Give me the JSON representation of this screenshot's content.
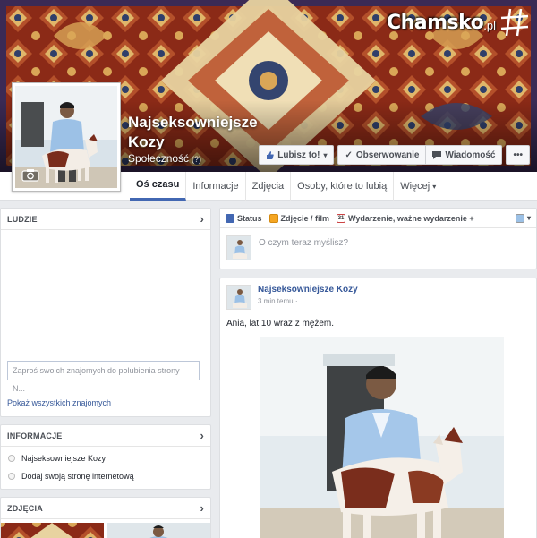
{
  "watermark": {
    "brand": "Chamsko",
    "suffix": ".pl"
  },
  "page": {
    "name": "Najseksowniejsze Kozy",
    "category": "Społeczność",
    "category_help": "(?)"
  },
  "cover_actions": {
    "like_label": "Lubisz to!",
    "follow_label": "Obserwowanie",
    "message_label": "Wiadomość",
    "more_label": "•••"
  },
  "tabs": [
    {
      "label": "Oś czasu"
    },
    {
      "label": "Informacje"
    },
    {
      "label": "Zdjęcia"
    },
    {
      "label": "Osoby, które to lubią"
    },
    {
      "label": "Więcej"
    }
  ],
  "sidebar": {
    "people": {
      "title": "LUDZIE",
      "invite_placeholder": "Zaproś swoich znajomych do polubienia strony N...",
      "show_all": "Pokaż wszystkich znajomych"
    },
    "info": {
      "title": "INFORMACJE",
      "items": [
        "Najseksowniejsze Kozy",
        "Dodaj swoją stronę internetową"
      ]
    },
    "photos": {
      "title": "ZDJĘCIA"
    }
  },
  "composer": {
    "tab_status": "Status",
    "tab_photo": "Zdjęcie / film",
    "tab_event": "Wydarzenie, ważne wydarzenie +",
    "placeholder": "O czym teraz myślisz?"
  },
  "post": {
    "author": "Najseksowniejsze Kozy",
    "time": "3 min temu",
    "text": "Ania, lat 10 wraz z mężem."
  }
}
